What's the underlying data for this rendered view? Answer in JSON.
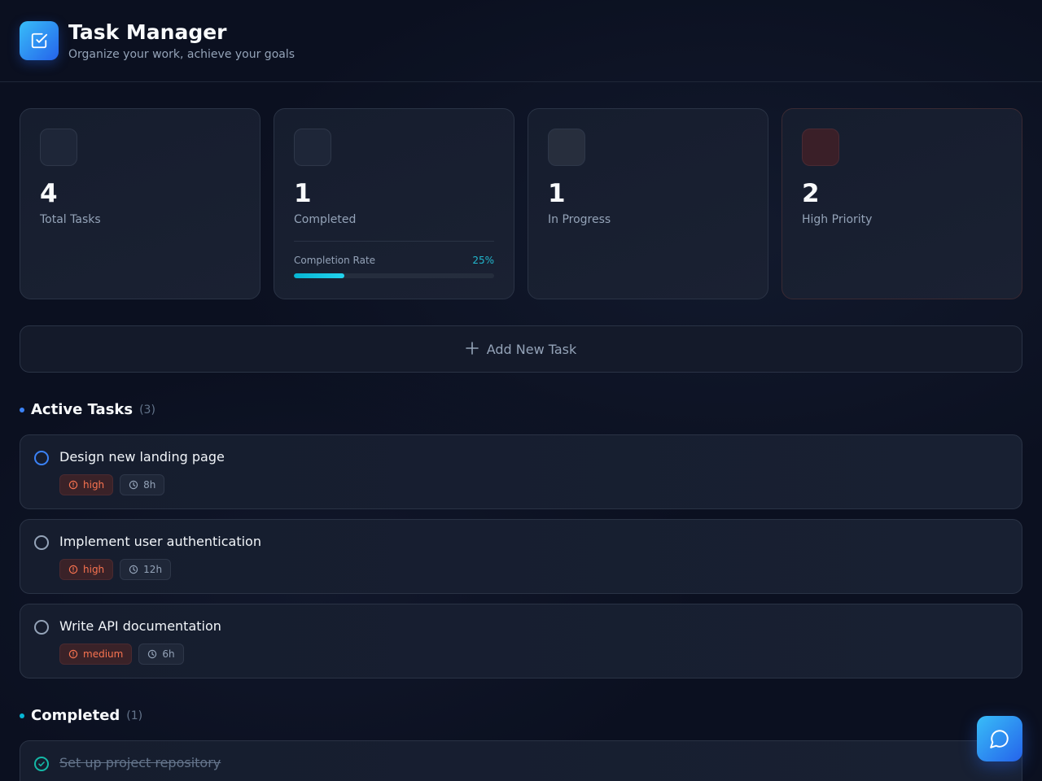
{
  "header": {
    "title": "Task Manager",
    "subtitle": "Organize your work, achieve your goals",
    "logo_icon": "checkbox-icon"
  },
  "stats": [
    {
      "value": "4",
      "label": "Total Tasks"
    },
    {
      "value": "1",
      "label": "Completed"
    },
    {
      "value": "1",
      "label": "In Progress"
    },
    {
      "value": "2",
      "label": "High Priority"
    }
  ],
  "completion": {
    "label": "Completion Rate",
    "percent_text": "25%",
    "fraction": 0.25
  },
  "add_task": {
    "label": "Add New Task",
    "icon": "plus-icon"
  },
  "active_section": {
    "title": "Active Tasks",
    "count": "(3)",
    "dot_color": "#3b82f6"
  },
  "active_tasks": [
    {
      "title": "Design new landing page",
      "priority": "high",
      "time": "8h"
    },
    {
      "title": "Implement user authentication",
      "priority": "high",
      "time": "12h"
    },
    {
      "title": "Write API documentation",
      "priority": "medium",
      "time": "6h"
    }
  ],
  "completed_section": {
    "title": "Completed",
    "count": "(1)",
    "dot_color": "#06b6d4"
  },
  "completed_tasks": [
    {
      "title": "Set up project repository"
    }
  ],
  "chat_button": {
    "icon": "chat-bubble-icon"
  },
  "colors": {
    "accent": "#3b82f6",
    "teal": "#06b6d4",
    "priority": "#f97350"
  }
}
